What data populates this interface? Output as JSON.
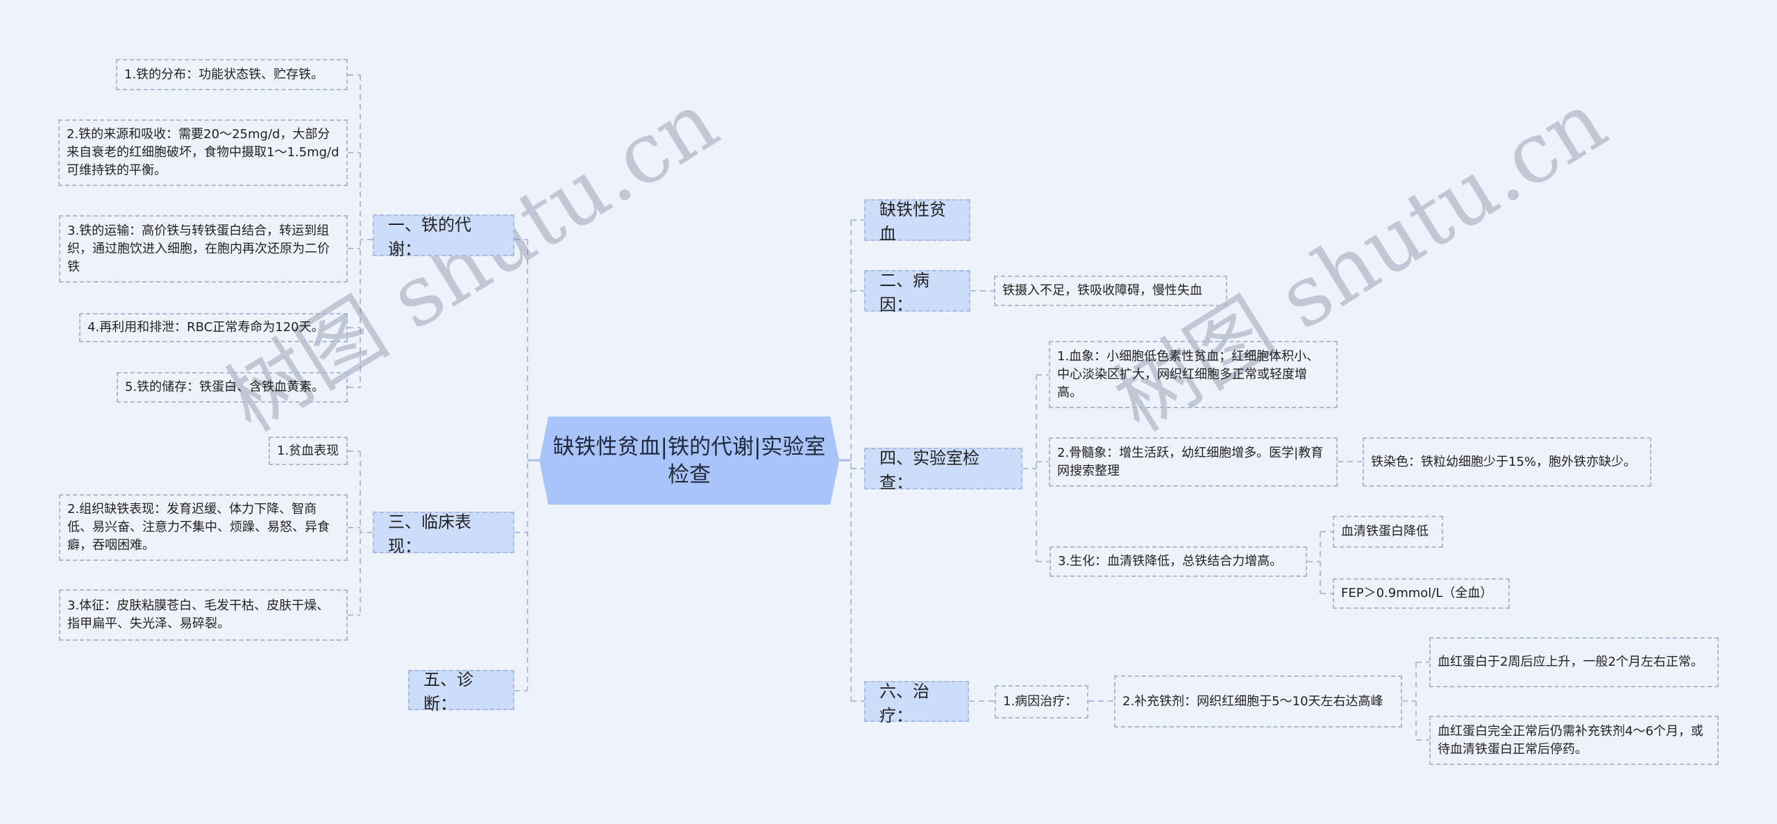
{
  "central": {
    "title": "缺铁性贫血|铁的代谢|实验室检查"
  },
  "colors": {
    "background": "#eef3fb",
    "central_fill": "#a9c3fb",
    "branch_fill": "#ccdcfb",
    "connector": "#a8bde8"
  },
  "left": {
    "metabolism": {
      "label": "一、铁的代谢：",
      "children": [
        "1.铁的分布：功能状态铁、贮存铁。",
        "2.铁的来源和吸收：需要20～25mg/d，大部分来自衰老的红细胞破坏，食物中摄取1～1.5mg/d可维持铁的平衡。",
        "3.铁的运输：高价铁与转铁蛋白结合，转运到组织，通过胞饮进入细胞，在胞内再次还原为二价铁",
        "4.再利用和排泄：RBC正常寿命为120天。",
        "5.铁的储存：铁蛋白、含铁血黄素。"
      ]
    },
    "clinical": {
      "label": "三、临床表现：",
      "children": [
        "1.贫血表现",
        "2.组织缺铁表现：发育迟缓、体力下降、智商低、易兴奋、注意力不集中、烦躁、易怒、异食癖，吞咽困难。",
        "3.体征：皮肤粘膜苍白、毛发干枯、皮肤干燥、指甲扁平、失光泽、易碎裂。"
      ]
    },
    "diagnosis": {
      "label": "五、诊断："
    }
  },
  "right": {
    "ida": {
      "label": "缺铁性贫血"
    },
    "cause": {
      "label": "二、病因：",
      "children": [
        "铁摄入不足，铁吸收障碍，慢性失血"
      ]
    },
    "lab": {
      "label": "四、实验室检查：",
      "children": [
        {
          "text": "1.血象：小细胞低色素性贫血；红细胞体积小、中心淡染区扩大，网织红细胞多正常或轻度增高。"
        },
        {
          "text": "2.骨髓象：增生活跃，幼红细胞增多。医学|教育网搜索整理",
          "children": [
            "铁染色：铁粒幼细胞少于15%，胞外铁亦缺少。"
          ]
        },
        {
          "text": "3.生化：血清铁降低，总铁结合力增高。",
          "children": [
            "血清铁蛋白降低",
            "FEP＞0.9mmol/L（全血）"
          ]
        }
      ]
    },
    "treatment": {
      "label": "六、治疗：",
      "children": [
        {
          "text": "1.病因治疗：",
          "children": [
            {
              "text": "2.补充铁剂：网织红细胞于5～10天左右达高峰",
              "children": [
                "血红蛋白于2周后应上升，一般2个月左右正常。",
                "血红蛋白完全正常后仍需补充铁剂4～6个月，或待血清铁蛋白正常后停药。"
              ]
            }
          ]
        }
      ]
    }
  },
  "watermark": {
    "text": "树图 shutu.cn"
  }
}
